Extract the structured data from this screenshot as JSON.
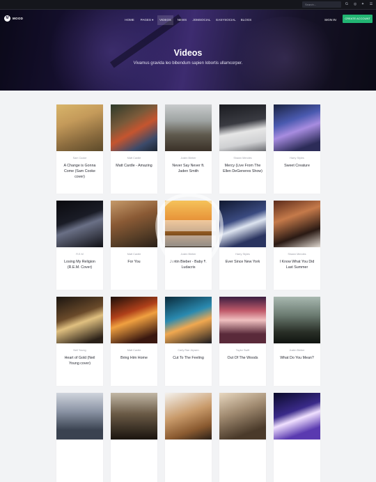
{
  "topbar": {
    "search_placeholder": "Search...",
    "social_icons": [
      "google-icon",
      "instagram-icon",
      "twitter-icon",
      "menu-icon"
    ]
  },
  "header": {
    "logo_text": "MOOD",
    "nav": [
      "HOME",
      "PAGES ▾",
      "VIDEOS",
      "NEWS",
      "JOMSOCIAL",
      "EASYSOCIAL",
      "BLOGS"
    ],
    "active_nav": "VIDEOS",
    "signin_label": "SIGN IN",
    "create_account_label": "CREATE ACCOUNT",
    "accent_color": "#22b573"
  },
  "hero": {
    "title": "Videos",
    "subtitle": "Vivamus gravida leo bibendum sapien lobortis ullamcorper."
  },
  "videos": [
    {
      "artist": "Sam Cooke",
      "title": "A Change is Gonna Come (Sam Cooke cover)"
    },
    {
      "artist": "Matt Cardle",
      "title": "Matt Cardle - Amazing"
    },
    {
      "artist": "Justin Bieber",
      "title": "Never Say Never ft. Jaden Smith"
    },
    {
      "artist": "Shawn Mendes",
      "title": "Mercy (Live From The Ellen DeGeneres Show)"
    },
    {
      "artist": "Harry Styles",
      "title": "Sweet Creature"
    },
    {
      "artist": "R.E.M",
      "title": "Losing My Religion (R.E.M. Cover)"
    },
    {
      "artist": "Matt Cardle",
      "title": "For You"
    },
    {
      "artist": "Justin Bieber",
      "title": "Justin Bieber - Baby ft. Ludacris"
    },
    {
      "artist": "Harry Styles",
      "title": "Ever Since New York"
    },
    {
      "artist": "Shawn Mendes",
      "title": "I Know What You Did Last Summer"
    },
    {
      "artist": "Neil Young",
      "title": "Heart of Gold (Neil Young cover)"
    },
    {
      "artist": "Matt Cardle",
      "title": "Bring Him Home"
    },
    {
      "artist": "Carly Rae Jepsen",
      "title": "Cut To The Feeling"
    },
    {
      "artist": "Taylor Swift",
      "title": "Out Of The Woods"
    },
    {
      "artist": "Justin Bieber",
      "title": "What Do You Mean?"
    },
    {
      "artist": "",
      "title": ""
    },
    {
      "artist": "",
      "title": ""
    },
    {
      "artist": "",
      "title": ""
    },
    {
      "artist": "",
      "title": ""
    },
    {
      "artist": "",
      "title": ""
    }
  ]
}
